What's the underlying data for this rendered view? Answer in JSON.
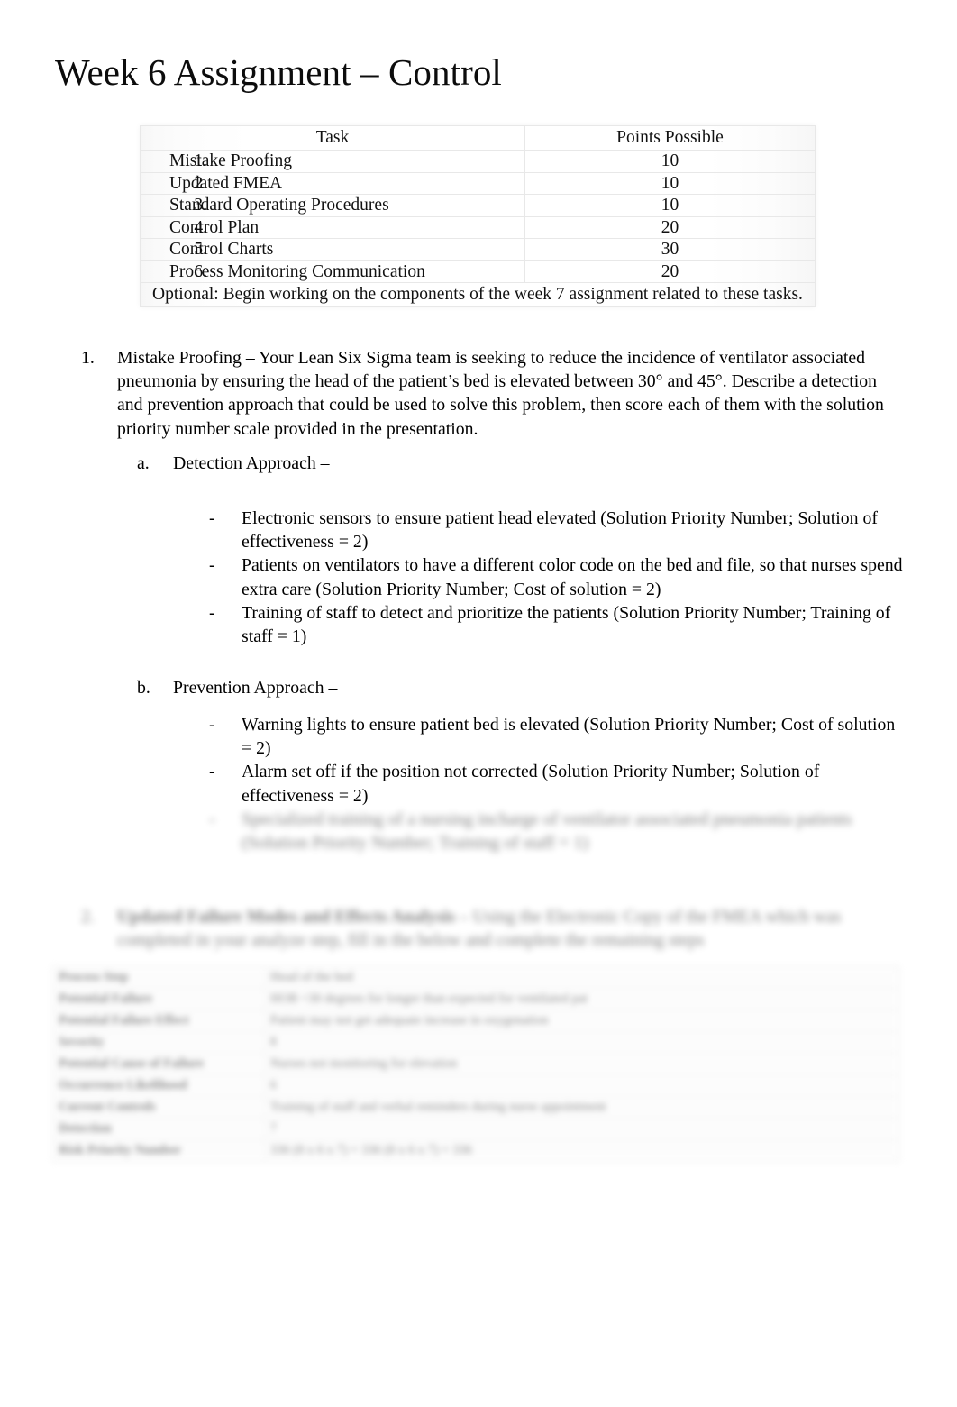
{
  "document": {
    "title": "Week 6 Assignment – Control"
  },
  "grading_table": {
    "headers": [
      "Task",
      "Points Possible"
    ],
    "rows": [
      {
        "number": "1.",
        "task": "Mistake Proofing",
        "points": "10"
      },
      {
        "number": "2.",
        "task": "Updated FMEA",
        "points": "10"
      },
      {
        "number": "3.",
        "task": "Standard Operating Procedures",
        "points": "10"
      },
      {
        "number": "4.",
        "task": "Control Plan",
        "points": "20"
      },
      {
        "number": "5.",
        "task": "Control Charts",
        "points": "30"
      },
      {
        "number": "6.",
        "task": "Process Monitoring Communication",
        "points": "20"
      }
    ],
    "footnote": "Optional: Begin working on the components of the week 7 assignment related to these tasks."
  },
  "items": {
    "item1": {
      "marker": "1.",
      "text": "Mistake Proofing – Your Lean Six Sigma team is seeking to reduce the incidence of ventilator associated pneumonia by ensuring the head of the patient’s bed is elevated between 30° and 45°. Describe a detection and prevention approach that could be used to solve this problem, then score each of them with the solution priority number scale provided in the presentation."
    },
    "detection": {
      "marker": "a.",
      "heading": "Detection Approach –",
      "bullets": [
        "Electronic sensors to ensure patient head elevated (Solution Priority Number; Solution of effectiveness = 2)",
        "Patients on ventilators to have a different color code on the bed and file, so that nurses spend extra care (Solution Priority Number; Cost of solution = 2)",
        "Training of staff to detect and prioritize the patients (Solution Priority Number; Training of staff = 1)"
      ]
    },
    "prevention": {
      "marker": "b.",
      "heading": "Prevention Approach  –",
      "bullets": [
        "Warning lights to ensure patient bed is elevated (Solution Priority Number; Cost of solution = 2)",
        "Alarm set off if the position not corrected (Solution Priority Number; Solution of effectiveness = 2)",
        "Specialized training of a nursing incharge of ventilator associated pneumonia patients (Solution Priority Number; Training of staff = 1)"
      ]
    },
    "item2": {
      "marker": "2.",
      "bold_lead": "Updated Failure Modes and Effects Analysis",
      "text": " – Using the Electronic Copy of the FMEA which was completed in your analyze step, fill in the below and complete the remaining steps"
    }
  },
  "fmea_table": {
    "rows": [
      {
        "label": "Process Step",
        "value": "Head of the bed"
      },
      {
        "label": "Potential Failure",
        "value": "HOB <30 degrees for longer than expected for ventilated pat"
      },
      {
        "label": "Potential Failure Effect",
        "value": "Patient may not get adequate increase in oxygenation"
      },
      {
        "label": "Severity",
        "value": "8"
      },
      {
        "label": "Potential Cause of Failure",
        "value": "Nurses not monitoring for elevation"
      },
      {
        "label": "Occurrence Likelihood",
        "value": "6"
      },
      {
        "label": "Current Controls",
        "value": "Training of staff and verbal reminders during nurse appointment"
      },
      {
        "label": "Detection",
        "value": "7"
      },
      {
        "label": "Risk Priority Number",
        "value": "336 (8 x 6 x 7) = 336 (8 x 6 x 7) = 336"
      }
    ]
  }
}
